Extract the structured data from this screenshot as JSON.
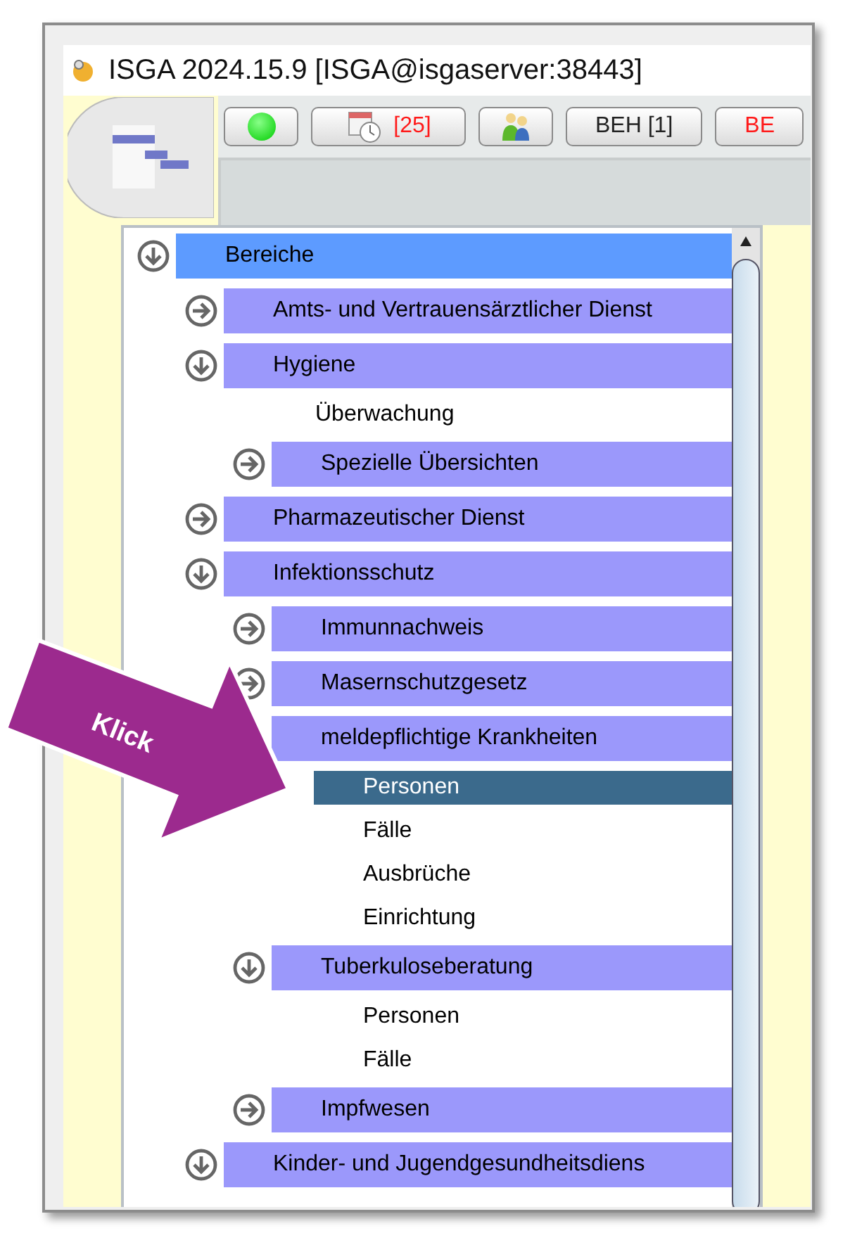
{
  "window": {
    "title": "ISGA 2024.15.9  [ISGA@isgaserver:38443]"
  },
  "toolbar": [
    {
      "kind": "status"
    },
    {
      "kind": "calendar",
      "label": "[25]",
      "alert": true
    },
    {
      "kind": "people"
    },
    {
      "kind": "text",
      "label": "BEH [1]",
      "alert": false
    },
    {
      "kind": "text",
      "label": "BE",
      "alert": true
    }
  ],
  "tree": [
    {
      "label": "Bereiche",
      "kind": "root",
      "expanded": true,
      "children": [
        {
          "label": "Amts- und Vertrauensärztlicher Dienst",
          "kind": "node",
          "expanded": false
        },
        {
          "label": "Hygiene",
          "kind": "node",
          "expanded": true,
          "children": [
            {
              "label": "Überwachung",
              "kind": "leaf",
              "selected": false
            },
            {
              "label": "Spezielle Übersichten",
              "kind": "node",
              "expanded": false
            }
          ]
        },
        {
          "label": "Pharmazeutischer Dienst",
          "kind": "node",
          "expanded": false
        },
        {
          "label": "Infektionsschutz",
          "kind": "node",
          "expanded": true,
          "children": [
            {
              "label": "Immunnachweis",
              "kind": "node",
              "expanded": false
            },
            {
              "label": "Masernschutzgesetz",
              "kind": "node",
              "expanded": false
            },
            {
              "label": "meldepflichtige Krankheiten",
              "kind": "node",
              "children": [
                {
                  "label": "Personen",
                  "kind": "leaf",
                  "selected": true
                },
                {
                  "label": "Fälle",
                  "kind": "leaf",
                  "selected": false
                },
                {
                  "label": "Ausbrüche",
                  "kind": "leaf",
                  "selected": false
                },
                {
                  "label": "Einrichtung",
                  "kind": "leaf",
                  "selected": false
                }
              ]
            },
            {
              "label": "Tuberkuloseberatung",
              "kind": "node",
              "expanded": true,
              "children": [
                {
                  "label": "Personen",
                  "kind": "leaf",
                  "selected": false
                },
                {
                  "label": "Fälle",
                  "kind": "leaf",
                  "selected": false
                }
              ]
            },
            {
              "label": "Impfwesen",
              "kind": "node",
              "expanded": false
            }
          ]
        },
        {
          "label": "Kinder- und Jugendgesundheitsdiens",
          "kind": "node",
          "expanded": true
        }
      ]
    }
  ],
  "callout": {
    "label": "Klick"
  }
}
